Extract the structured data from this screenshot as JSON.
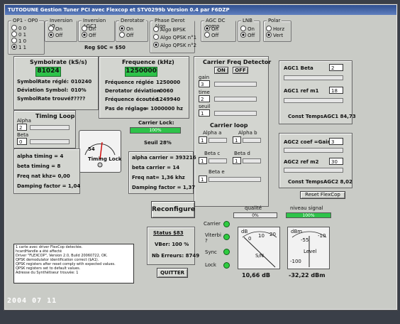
{
  "window_title": "TUTODUNE  Gestion Tuner PCI avec Flexcop et STV0299b Version 0.4 par F6DZP",
  "op_group": {
    "label": "OP1 - OP0",
    "options": [
      "0 0",
      "0 1",
      "1 0",
      "1 1"
    ],
    "selected": "1 1"
  },
  "inversion_iq": {
    "label": "Inversion IQ",
    "options": [
      "On",
      "Off"
    ],
    "selected": "Off"
  },
  "inversion_agc1": {
    "label": "Inversion AGC1",
    "options": [
      "On",
      "Off"
    ],
    "selected": "Off"
  },
  "derotator": {
    "label": "Derotator",
    "options": [
      "On",
      "Off"
    ],
    "selected": "On"
  },
  "reg_text": "Reg $0C = $50",
  "phase_derot": {
    "label": "Phase Derot Algo",
    "options": [
      "Algo BPSK",
      "Algo QPSK n°1",
      "Algo QPSK n°2"
    ],
    "selected": "Algo QPSK n°2"
  },
  "agc_dc": {
    "label": "AGC DC comp",
    "options": [
      "On",
      "Off"
    ],
    "selected": "On"
  },
  "lnb": {
    "label": "LNB",
    "options": [
      "On",
      "Off"
    ],
    "selected": "Off"
  },
  "polar": {
    "label": "Polar",
    "options": [
      "Horz",
      "Vert"
    ],
    "selected": "Vert"
  },
  "symbolrate": {
    "title": "Symbolrate (kS/s)",
    "value": "81024",
    "rows": [
      {
        "label": "SymbolRate réglé:",
        "value": "010240"
      },
      {
        "label": "Déviation Symbol:",
        "value": "010%"
      },
      {
        "label": "SymbolRate trouvé:",
        "value": "?????"
      }
    ]
  },
  "frequence": {
    "title": "Frequence (kHz)",
    "value": "1250000",
    "rows": [
      {
        "label": "Fréquence réglée",
        "value": "1250000"
      },
      {
        "label": "Derotator déviation",
        "value": "-0060"
      },
      {
        "label": "Fréquence écoutée",
        "value": "1249940"
      },
      {
        "label": "Pas de réglage",
        "value": "= 1000000 hz"
      }
    ]
  },
  "carrier_detector": {
    "title": "Carrier Freq Detector",
    "on": "ON",
    "off": "OFF",
    "gain_label": "gain",
    "gain_value": "3",
    "time_label": "time",
    "time_value": "2",
    "seuil_label": "seuil",
    "seuil_value": "1"
  },
  "carrier_loop": {
    "title": "Carrier loop",
    "alpha_a": {
      "label": "Alpha a",
      "value": "1"
    },
    "alpha_b": {
      "label": "Alpha b",
      "value": "1"
    },
    "beta_c": {
      "label": "Beta c",
      "value": "1"
    },
    "beta_d": {
      "label": "Beta d",
      "value": "1"
    },
    "beta_e": {
      "label": "Beta e",
      "value": "1"
    }
  },
  "timing_loop": {
    "title": "Timing Loop",
    "alpha_label": "Alpha",
    "alpha_value": "2",
    "beta_label": "Beta",
    "beta_value": "0"
  },
  "timing_stats": [
    "alpha timing = 4",
    "beta timing = 8",
    "Freq nat khz= 0,00",
    "Damping factor = 1,04"
  ],
  "timing_meter": {
    "label": "Timing Lock",
    "value_text": "54",
    "level": 0.54
  },
  "carrier_lock": {
    "label": "Carrier Lock:",
    "value": "100%",
    "seuil": "Seuil 28%",
    "level": 1.0
  },
  "carrier_stats": [
    "alpha carrier = 393216",
    "beta carrier = 14",
    "Freq nat= 1,36 khz",
    "Damping factor = 1,37"
  ],
  "agc1": {
    "beta_label": "AGC1 Beta",
    "beta_value": "2",
    "ref_label": "AGC1 ref m1",
    "ref_value": "18",
    "const": "Const TempsAGC1 84,73"
  },
  "agc2": {
    "coef_label": "AGC2 coef =Gain",
    "coef_value": "3",
    "ref_label": "AGC2 ref m2",
    "ref_value": "30",
    "const": "Const TempsAGC2 8,02"
  },
  "reset_button": "Reset FlexCop",
  "reconfigure_button": "Reconfigure",
  "status": {
    "title": "Status $83",
    "vber": "VBer: 100 %",
    "errors": "Nb Erreurs: 8749"
  },
  "quit_button": "QUITTER",
  "leds": [
    "Carrier",
    "Viterbi\n?",
    "Sync",
    "Lock"
  ],
  "qualite": {
    "label": "qualité",
    "value": "0%",
    "level": 0.0
  },
  "niveau": {
    "label": "niveau signal",
    "value": "100%",
    "level": 1.0
  },
  "sn_gauge": {
    "unit": "dB",
    "ticks": [
      "0",
      "10",
      "20"
    ],
    "name": "S/N",
    "readout": "10,66 dB"
  },
  "level_gauge": {
    "unit": "dBm",
    "ticks": [
      "-55",
      "-10"
    ],
    "min": "-100",
    "name": "Level",
    "readout": "-32,22 dBm"
  },
  "log_lines": [
    "1 carte avec driver FlexCop detectée.",
    "hcardHandle a été affecté",
    "Driver \"FLEXCOP\", Version 2.0, Build 20060722, OK.",
    "QPSK demodulator identification correct ($A1).",
    "QPSK registers after reset comply with expected values.",
    "QPSK registers set to default values.",
    "Adresse du Synthétiseur trouvée: 1"
  ],
  "date_stamp": "2004 07 11",
  "colors": {
    "green": "#2ec34a",
    "window": "#c9cbc6"
  }
}
